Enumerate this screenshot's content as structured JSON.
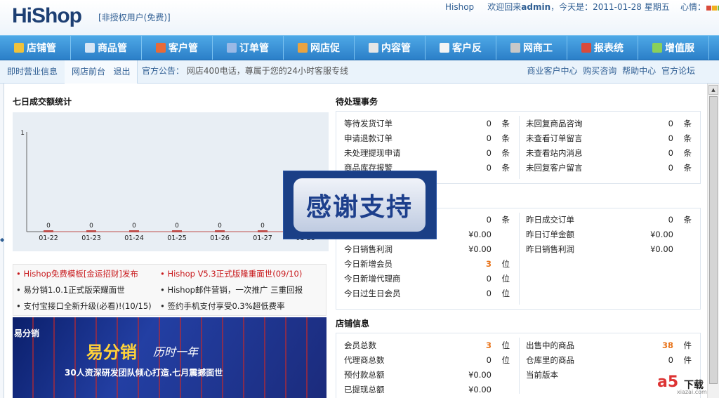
{
  "header": {
    "logo": "HiShop",
    "unauth": "[非授权用户(免费)]",
    "brand_link": "Hishop",
    "welcome": "欢迎回来",
    "username": "admin",
    "today": "，今天是：2011-01-28 星期五",
    "mood": "心情：",
    "mood_colors": [
      "#d94a3b",
      "#f2b01e",
      "#76b83b",
      "#e57c2a"
    ]
  },
  "nav": {
    "items": [
      {
        "label": "店铺管",
        "icon": "store-icon",
        "color": "#f0c23b"
      },
      {
        "label": "商品管",
        "icon": "grid-icon",
        "color": "#d7e6f5"
      },
      {
        "label": "客户管",
        "icon": "users-icon",
        "color": "#e86a38"
      },
      {
        "label": "订单管",
        "icon": "order-icon",
        "color": "#9ab9e6"
      },
      {
        "label": "网店促",
        "icon": "promo-icon",
        "color": "#e9a341"
      },
      {
        "label": "内容管",
        "icon": "pencil-icon",
        "color": "#e6e6e6"
      },
      {
        "label": "客户反",
        "icon": "chat-icon",
        "color": "#f4f4f4"
      },
      {
        "label": "网商工",
        "icon": "tools-icon",
        "color": "#c8c8c8"
      },
      {
        "label": "报表统",
        "icon": "report-icon",
        "color": "#d94a3b"
      },
      {
        "label": "增值服",
        "icon": "service-icon",
        "color": "#8ad05a"
      }
    ]
  },
  "subnav": {
    "tab_a": "即时营业信息",
    "tab_b": "网店前台",
    "tab_b2": "退出",
    "notice_label": "官方公告：",
    "notice_msg": "网店400电话，尊属于您的24小时客服专线",
    "links": [
      "商业客户中心",
      "购买咨询",
      "帮助中心",
      "官方论坛"
    ]
  },
  "chart_title": "七日成交额统计",
  "chart_data": {
    "type": "line",
    "categories": [
      "01-22",
      "01-23",
      "01-24",
      "01-25",
      "01-26",
      "01-27",
      "01-28"
    ],
    "values": [
      0,
      0,
      0,
      0,
      0,
      0,
      0
    ],
    "ylim": [
      0,
      1
    ],
    "yticks": [
      "1"
    ]
  },
  "news": [
    {
      "text": "Hishop免费模板[金运招财]发布",
      "red": true
    },
    {
      "text": "Hishop V5.3正式版隆重面世(09/10)",
      "red": true
    },
    {
      "text": "易分销1.0.1正式版荣耀面世",
      "red": false
    },
    {
      "text": "Hishop邮件营销，一次推广 三重回报",
      "red": false
    },
    {
      "text": "支付宝接口全新升级(必看)!(10/15)",
      "red": false
    },
    {
      "text": "签约手机支付享受0.3%超低费率",
      "red": false
    }
  ],
  "banner": {
    "title": "易分销",
    "slogan": "历时一年",
    "line": "30人资深研发团队倾心打造.七月震撼面世",
    "tag": "易分销"
  },
  "pending": {
    "title": "待处理事务",
    "left": [
      {
        "label": "等待发货订单",
        "value": "0",
        "unit": "条"
      },
      {
        "label": "申请退款订单",
        "value": "0",
        "unit": "条"
      },
      {
        "label": "未处理提现申请",
        "value": "0",
        "unit": "条"
      },
      {
        "label": "商品库存报警",
        "value": "0",
        "unit": "条"
      }
    ],
    "right": [
      {
        "label": "未回复商品咨询",
        "value": "0",
        "unit": "条"
      },
      {
        "label": "未查看订单留言",
        "value": "0",
        "unit": "条"
      },
      {
        "label": "未查看站内消息",
        "value": "0",
        "unit": "条"
      },
      {
        "label": "未回复客户留言",
        "value": "0",
        "unit": "条"
      }
    ]
  },
  "today": {
    "left": [
      {
        "label": "",
        "value": "0",
        "unit": "条",
        "orange": false
      },
      {
        "label": "",
        "value": "¥0.00",
        "unit": "",
        "orange": false
      },
      {
        "label": "今日销售利润",
        "value": "¥0.00",
        "unit": "",
        "orange": false
      },
      {
        "label": "今日新增会员",
        "value": "3",
        "unit": "位",
        "orange": true
      },
      {
        "label": "今日新增代理商",
        "value": "0",
        "unit": "位",
        "orange": false
      },
      {
        "label": "今日过生日会员",
        "value": "0",
        "unit": "位",
        "orange": false
      }
    ],
    "right": [
      {
        "label": "昨日成交订单",
        "value": "0",
        "unit": "条",
        "orange": false
      },
      {
        "label": "昨日订单金额",
        "value": "¥0.00",
        "unit": "",
        "orange": false
      },
      {
        "label": "昨日销售利润",
        "value": "¥0.00",
        "unit": "",
        "orange": false
      }
    ]
  },
  "store": {
    "title": "店铺信息",
    "left": [
      {
        "label": "会员总数",
        "value": "3",
        "unit": "位",
        "orange": true
      },
      {
        "label": "代理商总数",
        "value": "0",
        "unit": "位",
        "orange": false
      },
      {
        "label": "预付款总额",
        "value": "¥0.00",
        "unit": "",
        "orange": false
      },
      {
        "label": "已提现总额",
        "value": "¥0.00",
        "unit": "",
        "orange": false
      }
    ],
    "right": [
      {
        "label": "出售中的商品",
        "value": "38",
        "unit": "件",
        "orange": true
      },
      {
        "label": "仓库里的商品",
        "value": "0",
        "unit": "件",
        "orange": false
      },
      {
        "label": "当前版本",
        "value": "",
        "unit": "",
        "orange": false
      }
    ]
  },
  "popup": {
    "text": "感谢支持"
  },
  "watermark": {
    "a5": "a5",
    "dl": "下载",
    "sub": "xiazai.com"
  }
}
